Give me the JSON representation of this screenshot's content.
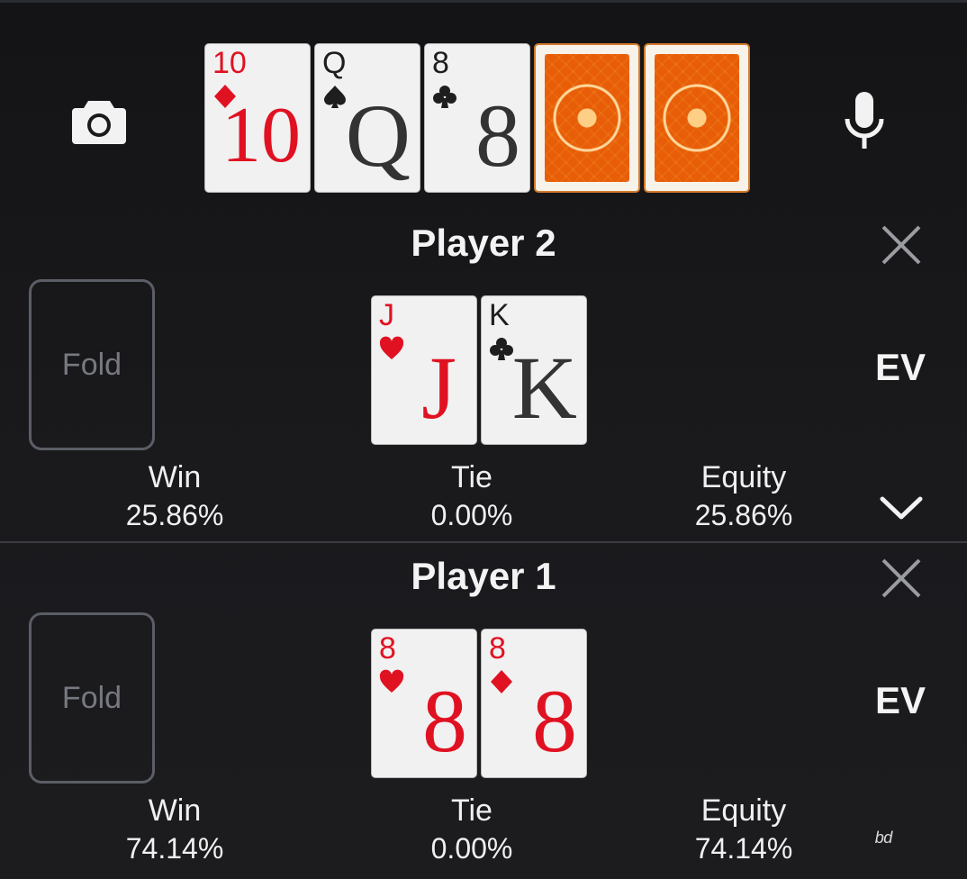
{
  "colors": {
    "background": "#161618",
    "red_suit": "#e01222",
    "black_suit": "#1e1e1e",
    "card_back": "#f39a2c",
    "fold_border": "#5b5e66"
  },
  "toolbar": {
    "camera_icon": "camera-icon",
    "mic_icon": "microphone-icon"
  },
  "board": [
    {
      "rank": "10",
      "suit": "diamonds",
      "color": "red"
    },
    {
      "rank": "Q",
      "suit": "spades",
      "color": "black"
    },
    {
      "rank": "8",
      "suit": "clubs",
      "color": "black"
    },
    {
      "face_down": true
    },
    {
      "face_down": true
    }
  ],
  "players": [
    {
      "title": "Player 2",
      "fold_label": "Fold",
      "ev_label": "EV",
      "cards": [
        {
          "rank": "J",
          "suit": "hearts",
          "color": "red"
        },
        {
          "rank": "K",
          "suit": "clubs",
          "color": "black"
        }
      ],
      "stats": {
        "win_label": "Win",
        "win": "25.86%",
        "tie_label": "Tie",
        "tie": "0.00%",
        "equity_label": "Equity",
        "equity": "25.86%"
      }
    },
    {
      "title": "Player 1",
      "fold_label": "Fold",
      "ev_label": "EV",
      "cards": [
        {
          "rank": "8",
          "suit": "hearts",
          "color": "red"
        },
        {
          "rank": "8",
          "suit": "diamonds",
          "color": "red"
        }
      ],
      "stats": {
        "win_label": "Win",
        "win": "74.14%",
        "tie_label": "Tie",
        "tie": "0.00%",
        "equity_label": "Equity",
        "equity": "74.14%"
      }
    }
  ],
  "bottom_right_label": "ᵇᵈ"
}
